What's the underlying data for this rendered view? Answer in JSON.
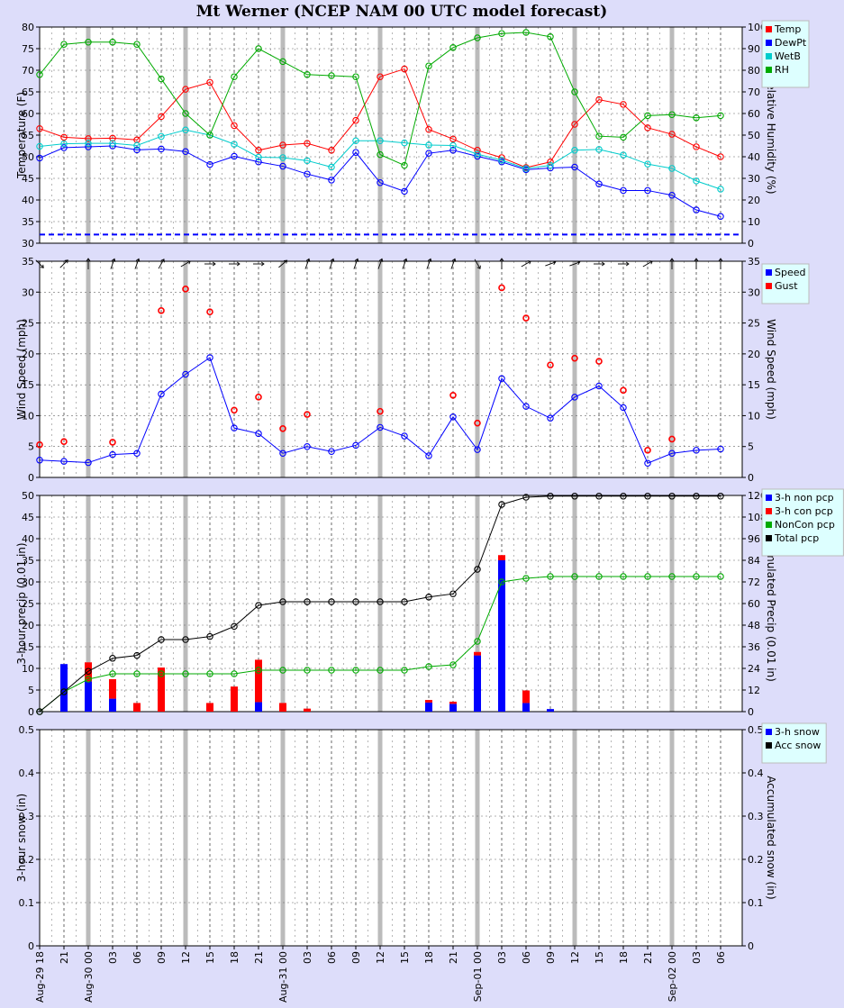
{
  "title": "Mt Werner (NCEP NAM 00 UTC model forecast)",
  "colors": {
    "red": "#ff0000",
    "blue": "#0000ff",
    "cyan": "#00cccc",
    "green": "#00aa00",
    "black": "#000000",
    "panel_bg": "#ffffff",
    "page_bg": "#ddddfa",
    "legend_bg": "#ddffff"
  },
  "x_labels": [
    "Aug-29 18",
    "21",
    "Aug-30 00",
    "03",
    "06",
    "09",
    "12",
    "15",
    "18",
    "21",
    "Aug-31 00",
    "03",
    "06",
    "09",
    "12",
    "15",
    "18",
    "21",
    "Sep-01 00",
    "03",
    "06",
    "09",
    "12",
    "15",
    "18",
    "21",
    "Sep-02 00",
    "03",
    "06"
  ],
  "chart_data": [
    {
      "type": "line",
      "ylabel": "Temperature (F)",
      "y2label": "Relative Humidity (%)",
      "ylim": [
        30,
        80
      ],
      "y2lim": [
        0,
        100
      ],
      "yticks": [
        "30",
        "35",
        "40",
        "45",
        "50",
        "55",
        "60",
        "65",
        "70",
        "75",
        "80"
      ],
      "y2ticks": [
        "0",
        "10",
        "20",
        "30",
        "40",
        "50",
        "60",
        "70",
        "80",
        "90",
        "100"
      ],
      "freezing_line": 32,
      "legend": [
        "Temp",
        "DewPt",
        "WetB",
        "RH"
      ],
      "series": [
        {
          "name": "Temp",
          "axis": "left",
          "color": "#ff0000",
          "values": [
            56.5,
            54.5,
            54.2,
            54.3,
            53.9,
            59.3,
            65.6,
            67.2,
            57.2,
            51.5,
            52.7,
            53.1,
            51.5,
            58.4,
            68.5,
            70.3,
            56.3,
            54.1,
            51.5,
            49.8,
            47.5,
            48.8,
            57.5,
            63.2,
            62.1,
            56.7,
            55.2,
            52.3,
            50.0
          ]
        },
        {
          "name": "DewPt",
          "axis": "left",
          "color": "#0000ff",
          "values": [
            49.7,
            52.1,
            52.3,
            52.5,
            51.6,
            51.8,
            51.2,
            48.2,
            50.1,
            48.8,
            47.8,
            46.0,
            44.6,
            51.0,
            44.0,
            42.0,
            50.8,
            51.5,
            50.1,
            48.8,
            47.0,
            47.4,
            47.6,
            43.7,
            42.2,
            42.2,
            41.1,
            37.7,
            36.2
          ]
        },
        {
          "name": "WetB",
          "axis": "left",
          "color": "#00cccc",
          "values": [
            52.4,
            53.0,
            53.1,
            53.1,
            52.6,
            54.7,
            56.2,
            55.0,
            52.9,
            49.9,
            49.8,
            49.1,
            47.6,
            53.7,
            53.7,
            53.2,
            52.7,
            52.6,
            50.6,
            49.2,
            47.3,
            48.0,
            51.5,
            51.7,
            50.4,
            48.3,
            47.3,
            44.4,
            42.5
          ]
        },
        {
          "name": "RH",
          "axis": "right",
          "color": "#00aa00",
          "values": [
            78,
            92,
            93,
            93,
            92,
            76,
            60,
            50,
            77,
            90,
            84,
            78,
            77.5,
            77,
            41,
            36,
            82,
            90.5,
            95,
            97,
            97.5,
            95.5,
            70,
            49.5,
            49,
            59,
            59.5,
            58,
            59
          ]
        }
      ]
    },
    {
      "type": "line",
      "ylabel": "Wind Speed (mph)",
      "y2label": "Wind Speed (mph)",
      "ylim": [
        0,
        35
      ],
      "yticks": [
        "0",
        "5",
        "10",
        "15",
        "20",
        "25",
        "30",
        "35"
      ],
      "legend": [
        "Speed",
        "Gust"
      ],
      "wind_dir_deg": [
        315,
        225,
        180,
        200,
        200,
        210,
        240,
        270,
        270,
        270,
        230,
        200,
        200,
        200,
        200,
        200,
        200,
        200,
        330,
        180,
        240,
        250,
        250,
        270,
        270,
        240,
        180,
        180,
        180
      ],
      "series": [
        {
          "name": "Speed",
          "color": "#0000ff",
          "values": [
            2.8,
            2.6,
            2.4,
            3.7,
            3.9,
            13.5,
            16.7,
            19.4,
            8.0,
            7.1,
            3.9,
            5.0,
            4.2,
            5.2,
            8.1,
            6.7,
            3.5,
            9.8,
            4.5,
            16.0,
            11.5,
            9.6,
            13.0,
            14.8,
            11.3,
            2.3,
            3.9,
            4.4,
            4.6
          ]
        },
        {
          "name": "Gust",
          "color": "#ff0000",
          "type": "scatter",
          "x": [
            0,
            1,
            3,
            5,
            6,
            7,
            8,
            9,
            10,
            11,
            14,
            17,
            18,
            19,
            20,
            21,
            22,
            23,
            24,
            25,
            26
          ],
          "values": [
            5.3,
            5.8,
            5.7,
            27.0,
            30.5,
            26.8,
            10.9,
            13.0,
            7.9,
            10.2,
            10.7,
            13.3,
            8.8,
            30.7,
            25.8,
            18.2,
            19.3,
            18.8,
            14.1,
            4.4,
            6.2
          ]
        }
      ]
    },
    {
      "type": "bar",
      "ylabel": "3-hour precip (0.01 in)",
      "y2label": "Accumulated Precip (0.01 in)",
      "ylim": [
        0,
        50
      ],
      "y2lim": [
        0,
        120
      ],
      "yticks": [
        "0",
        "5",
        "10",
        "15",
        "20",
        "25",
        "30",
        "35",
        "40",
        "45",
        "50"
      ],
      "y2ticks": [
        "0",
        "12",
        "24",
        "36",
        "48",
        "60",
        "72",
        "84",
        "96",
        "108",
        "120"
      ],
      "legend": [
        "3-h non pcp",
        "3-h con pcp",
        "NonCon pcp",
        "Total pcp"
      ],
      "series": [
        {
          "name": "3-h non pcp",
          "color": "#0000ff",
          "values": [
            0,
            11,
            7,
            3,
            0,
            0,
            0,
            0,
            0,
            2.2,
            0,
            0,
            0,
            0,
            0,
            0,
            2.1,
            1.8,
            13,
            35,
            2,
            0.6,
            0,
            0,
            0,
            0,
            0,
            0,
            0
          ]
        },
        {
          "name": "3-h con pcp",
          "color": "#ff0000",
          "values": [
            0,
            0,
            4.4,
            4.5,
            2,
            10.2,
            0,
            2,
            5.8,
            9.8,
            2,
            0.7,
            0,
            0,
            0,
            0,
            0.6,
            0.5,
            0.8,
            1.2,
            2.9,
            0,
            0,
            0,
            0,
            0,
            0,
            0,
            0
          ]
        },
        {
          "name": "NonCon pcp",
          "axis": "right",
          "color": "#00aa00",
          "type": "line",
          "values": [
            0,
            11,
            18,
            21,
            21,
            21,
            21,
            21,
            21,
            23,
            23,
            23,
            23,
            23,
            23,
            23,
            25,
            26,
            39,
            72,
            74,
            75,
            75,
            75,
            75,
            75,
            75,
            75,
            75
          ]
        },
        {
          "name": "Total pcp",
          "axis": "right",
          "color": "#000000",
          "type": "line",
          "values": [
            0,
            11,
            22.4,
            29.6,
            31.2,
            40,
            40,
            41.7,
            47.3,
            59,
            61,
            61,
            61,
            61,
            61,
            61,
            63.6,
            65.4,
            79,
            115,
            119,
            119.6,
            119.6,
            119.6,
            119.6,
            119.6,
            119.6,
            119.6,
            119.6
          ]
        }
      ]
    },
    {
      "type": "bar",
      "ylabel": "3-hour snow (in)",
      "y2label": "Accumulated snow (in)",
      "ylim": [
        0,
        0.5
      ],
      "y2lim": [
        0,
        0.5
      ],
      "yticks": [
        "0",
        "0.1",
        "0.2",
        "0.3",
        "0.4",
        "0.5"
      ],
      "y2ticks": [
        "0",
        "0.1",
        "0.2",
        "0.3",
        "0.4",
        "0.5"
      ],
      "legend": [
        "3-h snow",
        "Acc snow"
      ],
      "series": [
        {
          "name": "3-h snow",
          "color": "#0000ff",
          "values": [
            0,
            0,
            0,
            0,
            0,
            0,
            0,
            0,
            0,
            0,
            0,
            0,
            0,
            0,
            0,
            0,
            0,
            0,
            0,
            0,
            0,
            0,
            0,
            0,
            0,
            0,
            0,
            0,
            0
          ]
        },
        {
          "name": "Acc snow",
          "axis": "right",
          "color": "#000000",
          "type": "line",
          "values": [
            0,
            0,
            0,
            0,
            0,
            0,
            0,
            0,
            0,
            0,
            0,
            0,
            0,
            0,
            0,
            0,
            0,
            0,
            0,
            0,
            0,
            0,
            0,
            0,
            0,
            0,
            0,
            0,
            0
          ]
        }
      ]
    }
  ]
}
